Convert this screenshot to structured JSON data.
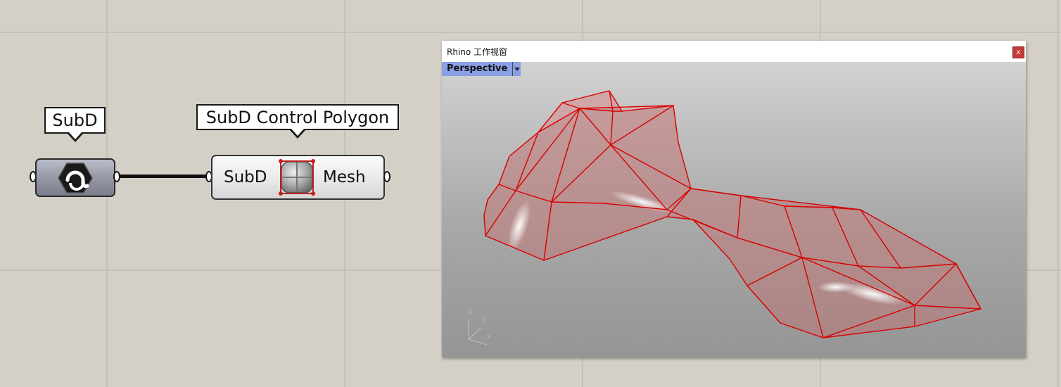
{
  "canvas": {
    "subd_param": {
      "tooltip": "SubD",
      "icon": "subd-icon"
    },
    "control_polygon": {
      "tooltip": "SubD Control Polygon",
      "input_label": "SubD",
      "output_label": "Mesh",
      "icon": "control-polygon-icon"
    }
  },
  "viewport_window": {
    "title": "Rhino 工作视窗",
    "close_label": "x",
    "view_name": "Perspective",
    "axes": {
      "x": "x",
      "y": "y",
      "z": "z"
    },
    "model_color": "#d80000"
  }
}
